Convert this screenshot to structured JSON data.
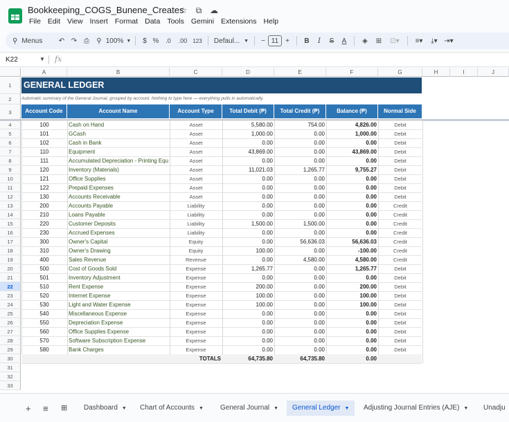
{
  "app": {
    "doc_title": "Bookkeeping_COGS_Bunene_Creates",
    "menu": [
      "File",
      "Edit",
      "View",
      "Insert",
      "Format",
      "Data",
      "Tools",
      "Gemini",
      "Extensions",
      "Help"
    ]
  },
  "toolbar": {
    "search_label": "Menus",
    "zoom": "100%",
    "currency": "$",
    "percent": "%",
    "dec_decrease": ".0",
    "dec_increase": ".00",
    "number_format": "123",
    "font": "Defaul...",
    "font_size": "11",
    "minus": "−",
    "plus": "+",
    "bold": "B",
    "italic": "I",
    "strike": "S",
    "text_color": "A"
  },
  "formula_bar": {
    "cell_ref": "K22",
    "fx": "fx"
  },
  "columns": [
    "A",
    "B",
    "C",
    "D",
    "E",
    "F",
    "G",
    "H",
    "I",
    "J"
  ],
  "rows": [
    "1",
    "2",
    "3",
    "4",
    "5",
    "6",
    "7",
    "8",
    "9",
    "10",
    "11",
    "12",
    "13",
    "14",
    "15",
    "16",
    "17",
    "18",
    "19",
    "20",
    "21",
    "22",
    "23",
    "24",
    "25",
    "26",
    "27",
    "28",
    "29",
    "30",
    "31",
    "32",
    "33"
  ],
  "active_row": "22",
  "sheet": {
    "title": "GENERAL LEDGER",
    "subtitle": "Automatic summary of the General Journal, grouped by account. Nothing to type here — everything pulls in automatically.",
    "headers": [
      "Account Code",
      "Account Name",
      "Account Type",
      "Total Debit (₱)",
      "Total Credit (₱)",
      "Balance (₱)",
      "Normal Side"
    ],
    "table": [
      [
        "100",
        "Cash on Hand",
        "Asset",
        "5,580.00",
        "754.00",
        "4,826.00",
        "Debit"
      ],
      [
        "101",
        "GCash",
        "Asset",
        "1,000.00",
        "0.00",
        "1,000.00",
        "Debit"
      ],
      [
        "102",
        "Cash in Bank",
        "Asset",
        "0.00",
        "0.00",
        "0.00",
        "Debit"
      ],
      [
        "110",
        "Equipment",
        "Asset",
        "43,869.00",
        "0.00",
        "43,869.00",
        "Debit"
      ],
      [
        "111",
        "Accumulated Depreciation - Printing Equ",
        "Asset",
        "0.00",
        "0.00",
        "0.00",
        "Debit"
      ],
      [
        "120",
        "Inventory (Materials)",
        "Asset",
        "11,021.03",
        "1,265.77",
        "9,755.27",
        "Debit"
      ],
      [
        "121",
        "Office Supplies",
        "Asset",
        "0.00",
        "0.00",
        "0.00",
        "Debit"
      ],
      [
        "122",
        "Prepaid Expenses",
        "Asset",
        "0.00",
        "0.00",
        "0.00",
        "Debit"
      ],
      [
        "130",
        "Accounts Receivable",
        "Asset",
        "0.00",
        "0.00",
        "0.00",
        "Debit"
      ],
      [
        "200",
        "Accounts Payable",
        "Liability",
        "0.00",
        "0.00",
        "0.00",
        "Credit"
      ],
      [
        "210",
        "Loans Payable",
        "Liability",
        "0.00",
        "0.00",
        "0.00",
        "Credit"
      ],
      [
        "220",
        "Customer Deposits",
        "Liability",
        "1,500.00",
        "1,500.00",
        "0.00",
        "Credit"
      ],
      [
        "230",
        "Accrued Expenses",
        "Liability",
        "0.00",
        "0.00",
        "0.00",
        "Credit"
      ],
      [
        "300",
        "Owner's Capital",
        "Equity",
        "0.00",
        "56,636.03",
        "56,636.03",
        "Credit"
      ],
      [
        "310",
        "Owner's Drawing",
        "Equity",
        "100.00",
        "0.00",
        "-100.00",
        "Credit"
      ],
      [
        "400",
        "Sales Revenue",
        "Revenue",
        "0.00",
        "4,580.00",
        "4,580.00",
        "Credit"
      ],
      [
        "500",
        "Cost of Goods Sold",
        "Expense",
        "1,265.77",
        "0.00",
        "1,265.77",
        "Debit"
      ],
      [
        "501",
        "Inventory Adjustment",
        "Expense",
        "0.00",
        "0.00",
        "0.00",
        "Debit"
      ],
      [
        "510",
        "Rent Expense",
        "Expense",
        "200.00",
        "0.00",
        "200.00",
        "Debit"
      ],
      [
        "520",
        "Internet Expense",
        "Expense",
        "100.00",
        "0.00",
        "100.00",
        "Debit"
      ],
      [
        "530",
        "Light and Water Expense",
        "Expense",
        "100.00",
        "0.00",
        "100.00",
        "Debit"
      ],
      [
        "540",
        "Miscellaneous Expense",
        "Expense",
        "0.00",
        "0.00",
        "0.00",
        "Debit"
      ],
      [
        "550",
        "Depreciation Expense",
        "Expense",
        "0.00",
        "0.00",
        "0.00",
        "Debit"
      ],
      [
        "560",
        "Office Supplies Expense",
        "Expense",
        "0.00",
        "0.00",
        "0.00",
        "Debit"
      ],
      [
        "570",
        "Software Subscription Expense",
        "Expense",
        "0.00",
        "0.00",
        "0.00",
        "Debit"
      ],
      [
        "580",
        "Bank Charges",
        "Expense",
        "0.00",
        "0.00",
        "0.00",
        "Debit"
      ]
    ],
    "totals": {
      "label": "TOTALS",
      "debit": "64,735.80",
      "credit": "64,735.80",
      "balance": "0.00"
    }
  },
  "sheet_tabs": [
    {
      "label": "Dashboard",
      "active": false
    },
    {
      "label": "Chart of Accounts",
      "active": false
    },
    {
      "label": "General Journal",
      "active": false
    },
    {
      "label": "General Ledger",
      "active": true
    },
    {
      "label": "Adjusting Journal Entries (AJE)",
      "active": false
    },
    {
      "label": "Unadju",
      "active": false
    }
  ],
  "colors": {
    "title_bg": "#1f4e79",
    "header_bg": "#2e75b6",
    "active_tab": "#0b57d0"
  }
}
